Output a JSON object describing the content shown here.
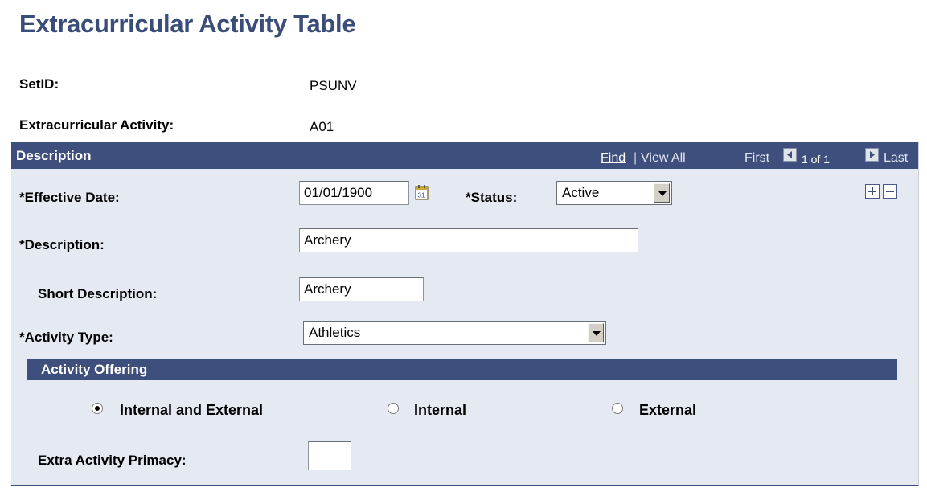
{
  "page_title": "Extracurricular Activity Table",
  "setid": {
    "label": "SetID:",
    "value": "PSUNV"
  },
  "activity": {
    "label": "Extracurricular Activity:",
    "value": "A01"
  },
  "panel": {
    "title": "Description",
    "nav": {
      "find": "Find",
      "separator": "|",
      "view_all": "View All",
      "first": "First",
      "count": "1 of 1",
      "last": "Last"
    }
  },
  "fields": {
    "effective_date": {
      "label": "*Effective Date:",
      "value": "01/01/1900"
    },
    "status": {
      "label": "*Status:",
      "value": "Active"
    },
    "description": {
      "label": "*Description:",
      "value": "Archery"
    },
    "short_description": {
      "label": "Short Description:",
      "value": "Archery"
    },
    "activity_type": {
      "label": "*Activity Type:",
      "value": "Athletics"
    },
    "extra_activity_primacy": {
      "label": "Extra Activity Primacy:",
      "value": ""
    }
  },
  "activity_offering": {
    "title": "Activity Offering",
    "options": [
      {
        "label": "Internal and External",
        "selected": true
      },
      {
        "label": "Internal",
        "selected": false
      },
      {
        "label": "External",
        "selected": false
      }
    ]
  },
  "colors": {
    "header": "#3e4e7d",
    "panel_bg": "#e5eaf2",
    "title": "#3a4c78"
  },
  "icons": {
    "calendar": "calendar-icon",
    "add_row": "plus-icon",
    "delete_row": "minus-icon"
  }
}
